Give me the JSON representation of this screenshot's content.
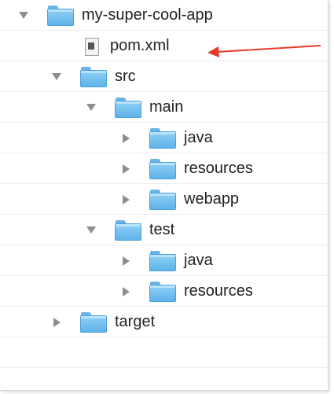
{
  "accent_color": "#e53b2a",
  "tree": {
    "root": {
      "label": "my-super-cool-app",
      "icon": "folder-icon",
      "expanded": true
    },
    "pom": {
      "label": "pom.xml",
      "icon": "xml-file-icon"
    },
    "src": {
      "label": "src",
      "icon": "folder-icon",
      "expanded": true
    },
    "main": {
      "label": "main",
      "icon": "folder-icon",
      "expanded": true
    },
    "main_java": {
      "label": "java",
      "icon": "folder-icon",
      "expanded": false
    },
    "main_resources": {
      "label": "resources",
      "icon": "folder-icon",
      "expanded": false
    },
    "main_webapp": {
      "label": "webapp",
      "icon": "folder-icon",
      "expanded": false
    },
    "test": {
      "label": "test",
      "icon": "folder-icon",
      "expanded": true
    },
    "test_java": {
      "label": "java",
      "icon": "folder-icon",
      "expanded": false
    },
    "test_resources": {
      "label": "resources",
      "icon": "folder-icon",
      "expanded": false
    },
    "target": {
      "label": "target",
      "icon": "folder-icon",
      "expanded": false
    }
  }
}
